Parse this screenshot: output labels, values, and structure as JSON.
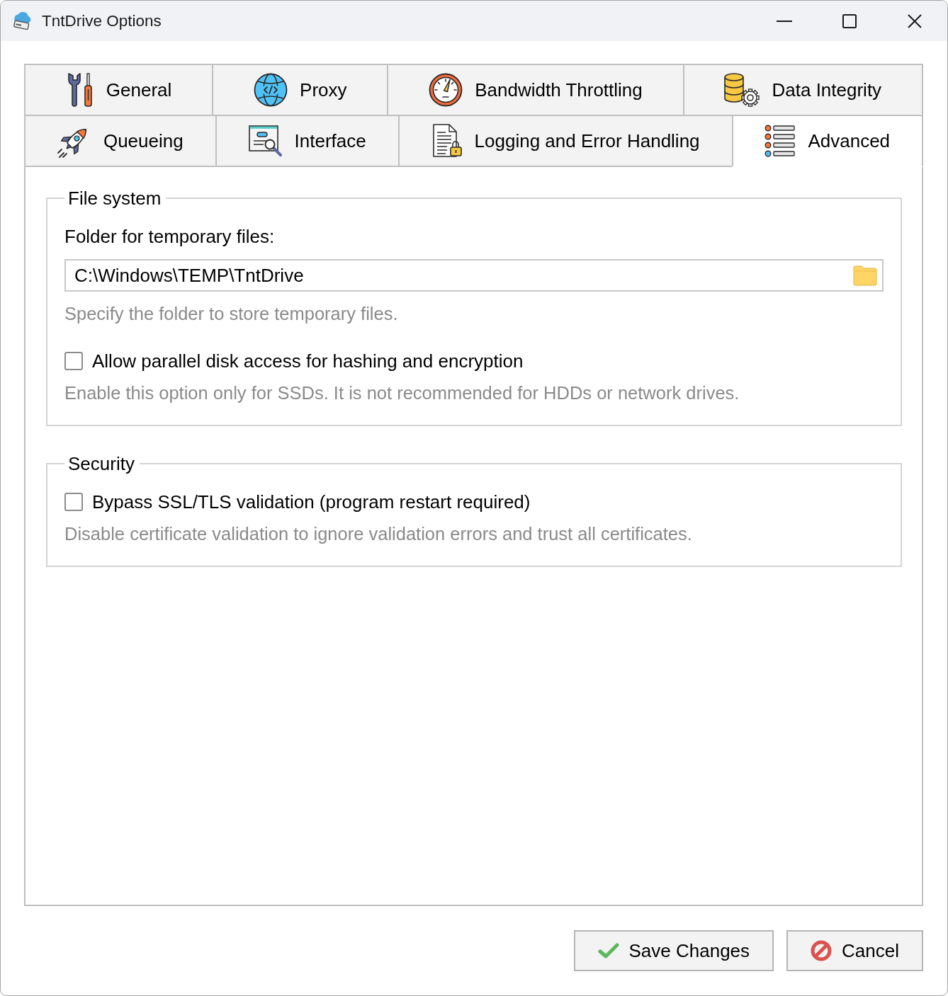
{
  "window": {
    "title": "TntDrive Options"
  },
  "tab_rows": [
    {
      "tabs": [
        {
          "label": "General",
          "selected": false
        },
        {
          "label": "Proxy",
          "selected": false
        },
        {
          "label": "Bandwidth Throttling",
          "selected": false
        },
        {
          "label": "Data Integrity",
          "selected": false
        }
      ]
    },
    {
      "tabs": [
        {
          "label": "Queueing",
          "selected": false
        },
        {
          "label": "Interface",
          "selected": false
        },
        {
          "label": "Logging and Error Handling",
          "selected": false
        },
        {
          "label": "Advanced",
          "selected": true
        }
      ]
    }
  ],
  "sections": [
    {
      "title": "File system",
      "items": [
        {
          "kind": "folder_field",
          "label": "Folder for temporary files:",
          "value": "C:\\Windows\\TEMP\\TntDrive",
          "hint": "Specify the folder to store temporary files."
        },
        {
          "kind": "checkbox",
          "label": "Allow parallel disk access for hashing and encryption",
          "checked": false,
          "hint": "Enable this option only for SSDs. It is not recommended for HDDs or network drives."
        }
      ]
    },
    {
      "title": "Security",
      "items": [
        {
          "kind": "checkbox",
          "label": "Bypass SSL/TLS validation (program restart required)",
          "checked": false,
          "hint": "Disable certificate validation to ignore validation errors and trust all certificates."
        }
      ]
    }
  ],
  "buttons": [
    {
      "kind": "save",
      "label": "Save Changes"
    },
    {
      "kind": "cancel",
      "label": "Cancel"
    }
  ]
}
